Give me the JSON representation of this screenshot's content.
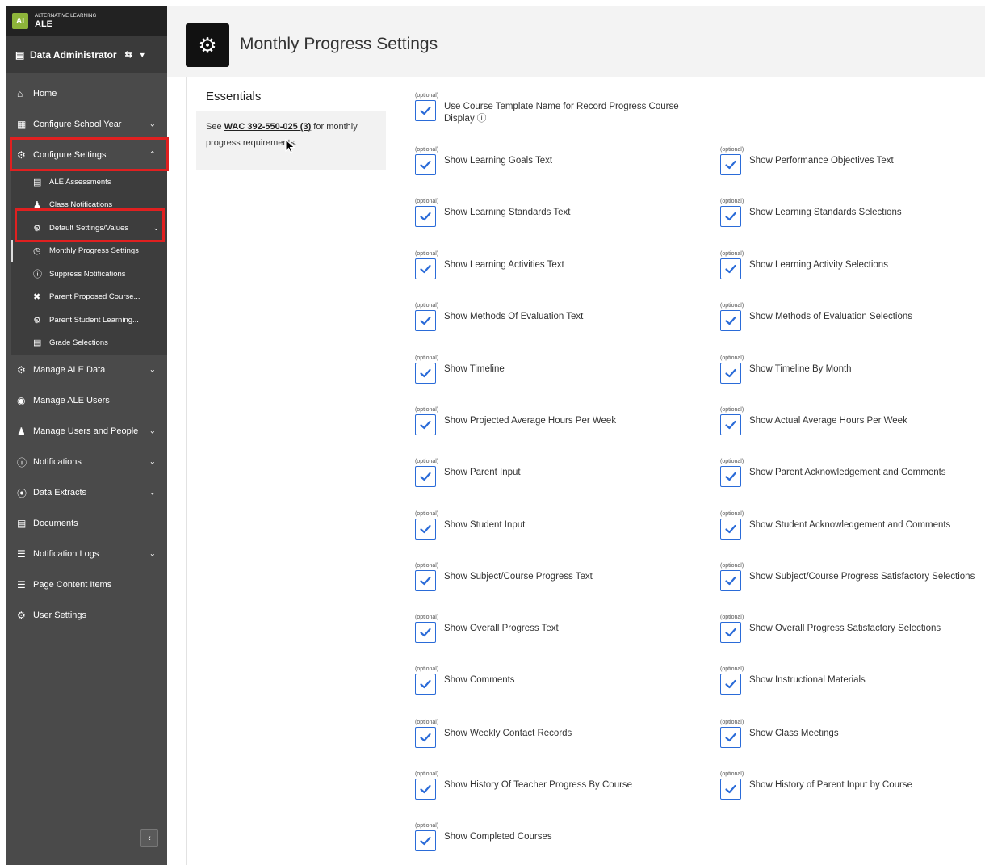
{
  "brand": {
    "logo": "AI",
    "subtitle": "ALTERNATIVE LEARNING",
    "name": "ALE"
  },
  "user": {
    "role": "Data Administrator"
  },
  "nav": {
    "home": "Home",
    "configure_school_year": "Configure School Year",
    "configure_settings": "Configure Settings",
    "sub": {
      "ale_assessments": "ALE Assessments",
      "class_notifications": "Class Notifications",
      "default_settings": "Default Settings/Values",
      "monthly_progress": "Monthly Progress Settings",
      "suppress_notifications": "Suppress Notifications",
      "parent_proposed": "Parent Proposed Course...",
      "parent_student": "Parent Student Learning...",
      "grade_selections": "Grade Selections"
    },
    "manage_ale_data": "Manage ALE Data",
    "manage_ale_users": "Manage ALE Users",
    "manage_users_people": "Manage Users and People",
    "notifications": "Notifications",
    "data_extracts": "Data Extracts",
    "documents": "Documents",
    "notification_logs": "Notification Logs",
    "page_content_items": "Page Content Items",
    "user_settings": "User Settings"
  },
  "page": {
    "title": "Monthly Progress Settings"
  },
  "essentials": {
    "title": "Essentials",
    "text_pre": "See ",
    "link": "WAC 392-550-025 (3)",
    "text_post": " for monthly progress requirements."
  },
  "optional_label": "(optional)",
  "settings": {
    "s0": {
      "label": "Use Course Template Name for Record Progress Course Display",
      "checked": true
    },
    "s1": {
      "label": "Show Learning Goals Text",
      "checked": true
    },
    "s2": {
      "label": "Show Performance Objectives Text",
      "checked": true
    },
    "s3": {
      "label": "Show Learning Standards Text",
      "checked": true
    },
    "s4": {
      "label": "Show Learning Standards Selections",
      "checked": true
    },
    "s5": {
      "label": "Show Learning Activities Text",
      "checked": true
    },
    "s6": {
      "label": "Show Learning Activity Selections",
      "checked": true
    },
    "s7": {
      "label": "Show Methods Of Evaluation Text",
      "checked": true
    },
    "s8": {
      "label": "Show Methods of Evaluation Selections",
      "checked": true
    },
    "s9": {
      "label": "Show Timeline",
      "checked": true
    },
    "s10": {
      "label": "Show Timeline By Month",
      "checked": true
    },
    "s11": {
      "label": "Show Projected Average Hours Per Week",
      "checked": true
    },
    "s12": {
      "label": "Show Actual Average Hours Per Week",
      "checked": true
    },
    "s13": {
      "label": "Show Parent Input",
      "checked": true
    },
    "s14": {
      "label": "Show Parent Acknowledgement and Comments",
      "checked": true
    },
    "s15": {
      "label": "Show Student Input",
      "checked": true
    },
    "s16": {
      "label": "Show Student Acknowledgement and Comments",
      "checked": true
    },
    "s17": {
      "label": "Show Subject/Course Progress Text",
      "checked": true
    },
    "s18": {
      "label": "Show Subject/Course Progress Satisfactory Selections",
      "checked": true
    },
    "s19": {
      "label": "Show Overall Progress Text",
      "checked": true
    },
    "s20": {
      "label": "Show Overall Progress Satisfactory Selections",
      "checked": true
    },
    "s21": {
      "label": "Show Comments",
      "checked": true
    },
    "s22": {
      "label": "Show Instructional Materials",
      "checked": true
    },
    "s23": {
      "label": "Show Weekly Contact Records",
      "checked": true
    },
    "s24": {
      "label": "Show Class Meetings",
      "checked": true
    },
    "s25": {
      "label": "Show History Of Teacher Progress By Course",
      "checked": true
    },
    "s26": {
      "label": "Show History of Parent Input by Course",
      "checked": true
    },
    "s27": {
      "label": "Show Completed Courses",
      "checked": true
    }
  },
  "colors": {
    "checkbox": "#2a6bd8",
    "highlight": "#e02020",
    "sidebar": "#4a4a4a"
  }
}
